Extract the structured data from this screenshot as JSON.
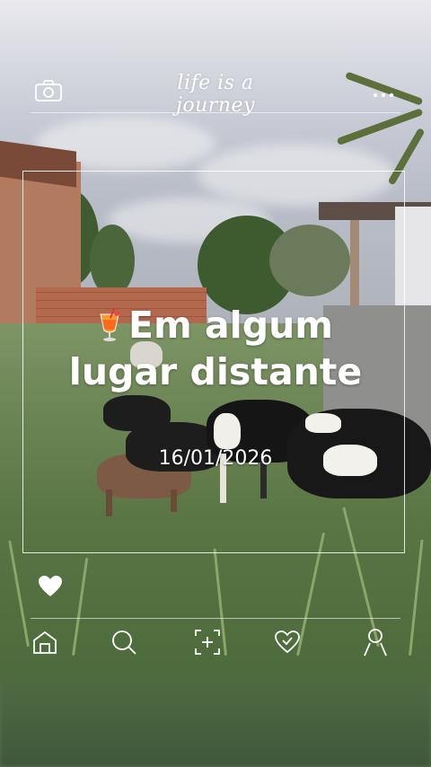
{
  "header": {
    "title": "life is a journey",
    "camera_icon": "camera-icon",
    "menu_icon": "more-dots-icon"
  },
  "post": {
    "caption_emoji": "tropical-drink-icon",
    "caption_line1": "Em algum",
    "caption_line2": "lugar distante",
    "date": "16/01/2026",
    "like_icon": "heart-icon"
  },
  "bottom_nav": {
    "items": [
      {
        "name": "home",
        "icon": "home-icon"
      },
      {
        "name": "search",
        "icon": "search-icon"
      },
      {
        "name": "add",
        "icon": "add-post-icon"
      },
      {
        "name": "activity",
        "icon": "heart-outline-icon"
      },
      {
        "name": "profile",
        "icon": "profile-icon"
      }
    ]
  },
  "colors": {
    "overlay_text": "#ffffff",
    "frame": "#ffffff"
  }
}
